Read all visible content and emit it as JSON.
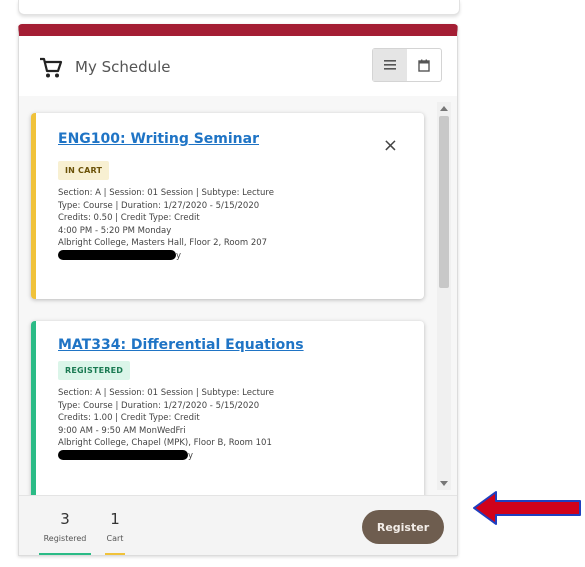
{
  "header": {
    "title": "My Schedule",
    "cart_icon": "cart-icon",
    "list_view_icon": "list-icon",
    "calendar_view_icon": "calendar-icon"
  },
  "cards": [
    {
      "title": "ENG100: Writing Seminar",
      "status": "IN CART",
      "status_color": "#f0c23a",
      "lines": [
        "Section: A | Session: 01 Session | Subtype: Lecture",
        "Type: Course | Duration: 1/27/2020 - 5/15/2020",
        "Credits: 0.50 | Credit Type: Credit",
        "4:00 PM - 5:20 PM Monday",
        "Albright College, Masters Hall, Floor 2, Room 207"
      ],
      "redacted_tail": "y",
      "close_label": "×"
    },
    {
      "title": "MAT334: Differential Equations",
      "status": "REGISTERED",
      "status_color": "#2bbb86",
      "lines": [
        "Section: A | Session: 01 Session | Subtype: Lecture",
        "Type: Course | Duration: 1/27/2020 - 5/15/2020",
        "Credits: 1.00 | Credit Type: Credit",
        "9:00 AM - 9:50 AM MonWedFri",
        "Albright College, Chapel (MPK), Floor B, Room 101"
      ],
      "redacted_tail": "y"
    }
  ],
  "footer": {
    "registered_count": "3",
    "registered_label": "Registered",
    "cart_count": "1",
    "cart_label": "Cart",
    "register_label": "Register"
  },
  "colors": {
    "accent": "#a41e34",
    "register_button": "#6e5d4f",
    "link": "#1f74c5",
    "annotation_arrow": "#d0021b"
  }
}
